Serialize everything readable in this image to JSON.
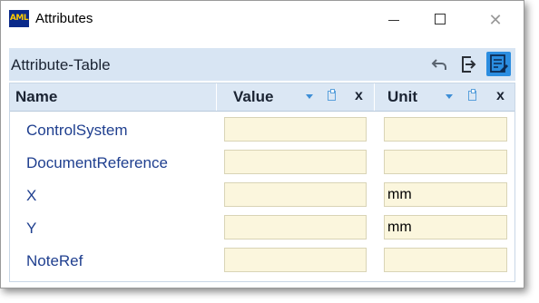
{
  "window": {
    "app_icon_text": "AML",
    "title": "Attributes",
    "minimize_icon": "minimize-icon",
    "maximize_icon": "maximize-icon",
    "close_icon": "close-icon",
    "close_glyph": "✕"
  },
  "panel": {
    "title": "Attribute-Table",
    "toolbar": [
      "undo-icon",
      "export-icon",
      "edit-table-icon"
    ]
  },
  "table": {
    "columns": {
      "name": "Name",
      "value": "Value",
      "unit": "Unit",
      "clear_label": "x"
    },
    "rows": [
      {
        "name": "ControlSystem",
        "value": "",
        "unit": ""
      },
      {
        "name": "DocumentReference",
        "value": "",
        "unit": ""
      },
      {
        "name": "X",
        "value": "",
        "unit": "mm"
      },
      {
        "name": "Y",
        "value": "",
        "unit": "mm"
      },
      {
        "name": "NoteRef",
        "value": "",
        "unit": ""
      }
    ]
  },
  "colors": {
    "header_bg": "#d8e5f3",
    "cell_bg": "#fbf6dd",
    "name_text": "#1f3f8f",
    "accent": "#2b8de0"
  }
}
